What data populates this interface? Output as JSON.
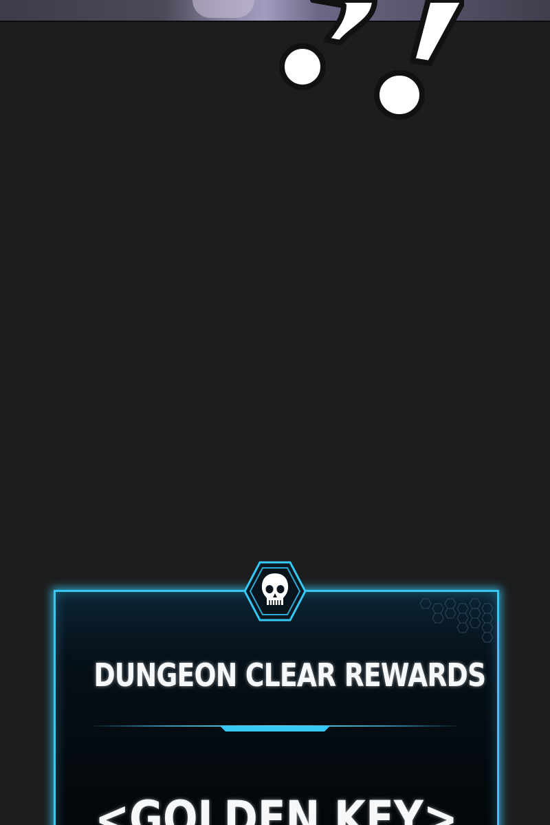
{
  "panel": {
    "sfx_text": "?!",
    "reward_window": {
      "emblem_icon": "skull-icon",
      "title": "DUNGEON CLEAR REWARDS",
      "item": "<GOLDEN KEY>",
      "accent_color": "#36c7f2",
      "text_color": "#f6f8fa",
      "background_color": "#1d1d1d"
    }
  }
}
